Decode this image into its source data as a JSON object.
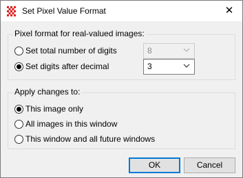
{
  "window": {
    "title": "Set Pixel Value Format",
    "close_glyph": "✕"
  },
  "pixel_format": {
    "group_label": "Pixel format for real-valued images:",
    "total_digits": {
      "label": "Set total number of digits",
      "checked": false,
      "value": "8",
      "enabled": false
    },
    "digits_after_decimal": {
      "label": "Set digits after decimal",
      "checked": true,
      "value": "3",
      "enabled": true
    }
  },
  "apply": {
    "group_label": "Apply changes to:",
    "options": [
      {
        "label": "This image only",
        "checked": true
      },
      {
        "label": "All images in this window",
        "checked": false
      },
      {
        "label": "This window and all future windows",
        "checked": false
      }
    ]
  },
  "buttons": {
    "ok": "OK",
    "cancel": "Cancel"
  },
  "icons": {
    "app": "red-grid-icon",
    "close": "close-icon",
    "dropdown": "chevron-down-icon"
  },
  "colors": {
    "icon_red": "#e02020",
    "accent": "#0078d7"
  }
}
